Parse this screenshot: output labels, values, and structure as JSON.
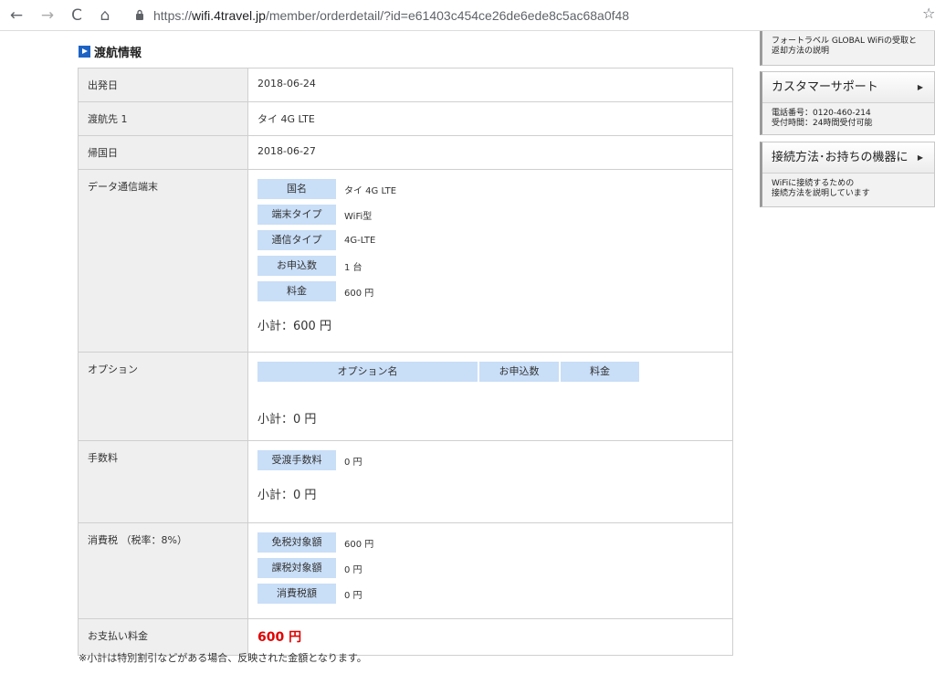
{
  "browser": {
    "back_icon": "←",
    "forward_icon": "→",
    "reload_icon": "C",
    "home_icon": "⌂",
    "url_scheme": "https://",
    "url_host": "wifi.4travel.jp",
    "url_path": "/member/orderdetail/?id=e61403c454ce26de6ede8c5ac68a0f48",
    "star_icon": "☆"
  },
  "section": {
    "title": "渡航情報"
  },
  "rows": {
    "departure": {
      "label": "出発日",
      "value": "2018-06-24"
    },
    "destination": {
      "label": "渡航先 1",
      "value": "タイ 4G LTE"
    },
    "return": {
      "label": "帰国日",
      "value": "2018-06-27"
    },
    "device": {
      "label": "データ通信端末",
      "items": [
        {
          "key": "国名",
          "value": "タイ 4G LTE"
        },
        {
          "key": "端末タイプ",
          "value": "WiFi型"
        },
        {
          "key": "通信タイプ",
          "value": "4G-LTE"
        },
        {
          "key": "お申込数",
          "value": "1 台"
        },
        {
          "key": "料金",
          "value": "600 円"
        }
      ],
      "subtotal": "小計：600 円"
    },
    "option": {
      "label": "オプション",
      "headers": [
        "オプション名",
        "お申込数",
        "料金"
      ],
      "subtotal": "小計：0 円"
    },
    "fee": {
      "label": "手数料",
      "items": [
        {
          "key": "受渡手数料",
          "value": "0 円"
        }
      ],
      "subtotal": "小計：0 円"
    },
    "tax": {
      "label": "消費税 （税率：8%）",
      "items": [
        {
          "key": "免税対象額",
          "value": "600 円"
        },
        {
          "key": "課税対象額",
          "value": "0 円"
        },
        {
          "key": "消費税額",
          "value": "0 円"
        }
      ]
    },
    "payment": {
      "label": "お支払い料金",
      "value": "600 円"
    }
  },
  "note": "※小計は特別割引などがある場合、反映された金額となります。",
  "sidebar": {
    "pickup_text": "フォートラベル GLOBAL WiFiの受取と返却方法の説明",
    "support": {
      "title": "カスタマーサポート",
      "arrow": "▶",
      "line1": "電話番号：0120-460-214",
      "line2": "受付時間：24時間受付可能"
    },
    "connect": {
      "title": "接続方法･お持ちの機器に",
      "arrow": "▶",
      "line1": "WiFiに接続するための",
      "line2": "接続方法を説明しています"
    }
  },
  "colors": {
    "accent": "#1d63c4",
    "label_bg": "#c9def7",
    "total": "#e10000"
  }
}
